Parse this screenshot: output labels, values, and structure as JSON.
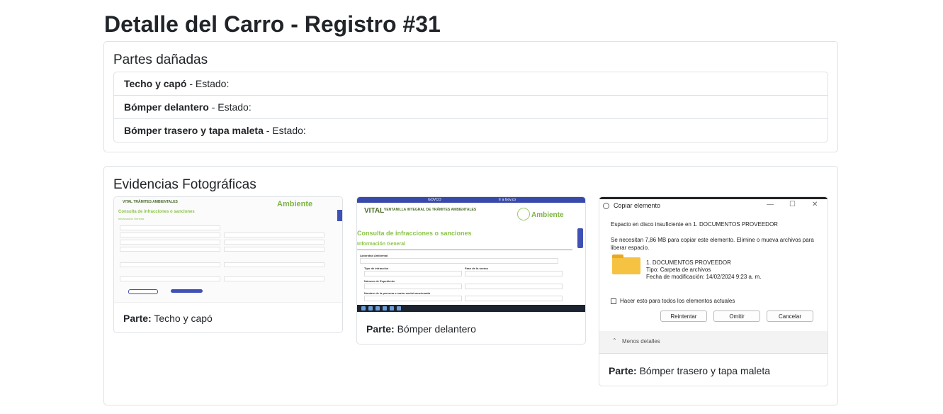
{
  "header": {
    "title": "Detalle del Carro - Registro #31"
  },
  "partes": {
    "heading": "Partes dañadas",
    "items": [
      {
        "name": "Techo y capó",
        "suffix": " - Estado:"
      },
      {
        "name": "Bómper delantero",
        "suffix": " - Estado:"
      },
      {
        "name": "Bómper trasero y tapa maleta",
        "suffix": " - Estado:"
      }
    ]
  },
  "evidencias": {
    "heading": "Evidencias Fotográficas",
    "part_label": "Parte:",
    "photos": [
      {
        "part": "Techo y capó"
      },
      {
        "part": "Bómper delantero"
      },
      {
        "part": "Bómper trasero y tapa maleta"
      }
    ]
  },
  "shot1": {
    "logo": "VITAL TRÁMITES AMBIENTALES",
    "brand": "Ambiente",
    "heading": "Consulta de infracciones o sanciones",
    "sub": "Información General"
  },
  "shot2": {
    "top_left": "GOVCO",
    "top_right": "Ir a Gov.co",
    "logo": "VITAL",
    "logo_sub": "VENTANILLA INTEGRAL DE TRÁMITES AMBIENTALES",
    "brand": "Ambiente",
    "heading": "Consulta de infracciones o sanciones",
    "sub": "Información General",
    "labels": [
      "Autoridad Ambiental",
      "Tipo de infracción",
      "Fase de la norma",
      "Número de Expediente",
      "Nombre de la persona o razón social sancionada"
    ]
  },
  "dialog": {
    "title": "Copiar elemento",
    "line1": "Espacio en disco insuficiente en 1. DOCUMENTOS PROVEEDOR",
    "line2": "Se necesitan 7,86 MB para copiar este elemento. Elimine o mueva archivos para liberar espacio.",
    "item_name": "1. DOCUMENTOS PROVEEDOR",
    "item_type": "Tipo: Carpeta de archivos",
    "item_date": "Fecha de modificación: 14/02/2024 9:23 a. m.",
    "checkbox_label": "Hacer esto para todos los elementos actuales",
    "buttons": [
      "Reintentar",
      "Omitir",
      "Cancelar"
    ],
    "less_details": "Menos detalles"
  }
}
